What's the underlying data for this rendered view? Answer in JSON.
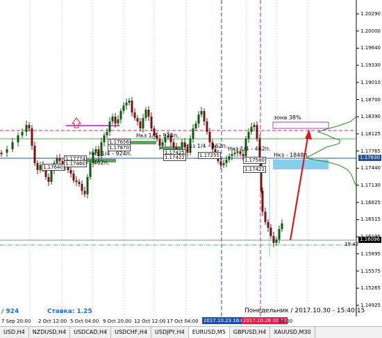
{
  "price_axis": {
    "labels": [
      "1.20290",
      "1.20000",
      "1.19640",
      "1.19330",
      "1.19010",
      "1.18700",
      "1.18390",
      "1.18125",
      "1.17765",
      "1.17440",
      "1.17130",
      "1.16825",
      "1.16515",
      "1.16195",
      "1.15895",
      "1.15575",
      "1.15265",
      "1.14925"
    ],
    "current_price": "1.17630",
    "current_price_color": "#1f4fa3",
    "low_price": "1.16096",
    "low_price_color": "#000000"
  },
  "time_axis": {
    "labels": [
      "7 Sep 20:00",
      "2 Oct 12:00",
      "5 Oct 04:00",
      "9 Oct 20:00",
      "12 Oct 12:00",
      "17 Oct 04:00"
    ],
    "highlight_blue": "2017.10.23 16:00",
    "highlight_blue_color": "#1f4fa3",
    "highlight_red": "2017.10.26 20:00",
    "highlight_red_color": "#e0204a",
    "tail_label": "04:00"
  },
  "annotations": {
    "zone_label": "зона 38%",
    "nkz_label_1": "Нкз 1/4 - 924п.",
    "nkz_label_2": "Нкз 1/4 - 924п.",
    "nkz_label_3": "Нкз 1/4 - 462п.",
    "nkz_label_4": "Нкз 1/4 - 462п.",
    "nkz_label_5": "Нкз 1/4 - 462п.",
    "nkz_label_6": "Нкз - 1848п.",
    "time_marker": "19:45",
    "price_boxes": [
      "1.17774",
      "1.17656",
      "1.17870",
      "1.17640",
      "1.17425",
      "1.17255",
      "1.17460",
      "1.17422",
      "1.17580",
      "1.17422"
    ]
  },
  "info_bar": {
    "left": "/ 924",
    "stake": "Ставка: 1.25",
    "date": "Понедельник  /  2017.10.30 - 15:40:15"
  },
  "tabs": [
    {
      "label": "USD,H4"
    },
    {
      "label": "NZDUSD,H4"
    },
    {
      "label": "USDCAD,H4"
    },
    {
      "label": "USDCHF,H4"
    },
    {
      "label": "USDJPY,H4"
    },
    {
      "label": "EURUSD,M5"
    },
    {
      "label": "GBPUSD,H4"
    },
    {
      "label": "XAUUSD,M30"
    }
  ],
  "colors": {
    "bull_candle": "#0c5c0c",
    "bear_candle": "#7a1010",
    "support_line": "#4caf50",
    "red_dash": "#e0204a",
    "zone_box": "#87ceeb",
    "arrow": "#e0141e",
    "up_arrow": "#e0141e",
    "magenta_line": "#e040e0",
    "grid": "#d0d0d0"
  }
}
